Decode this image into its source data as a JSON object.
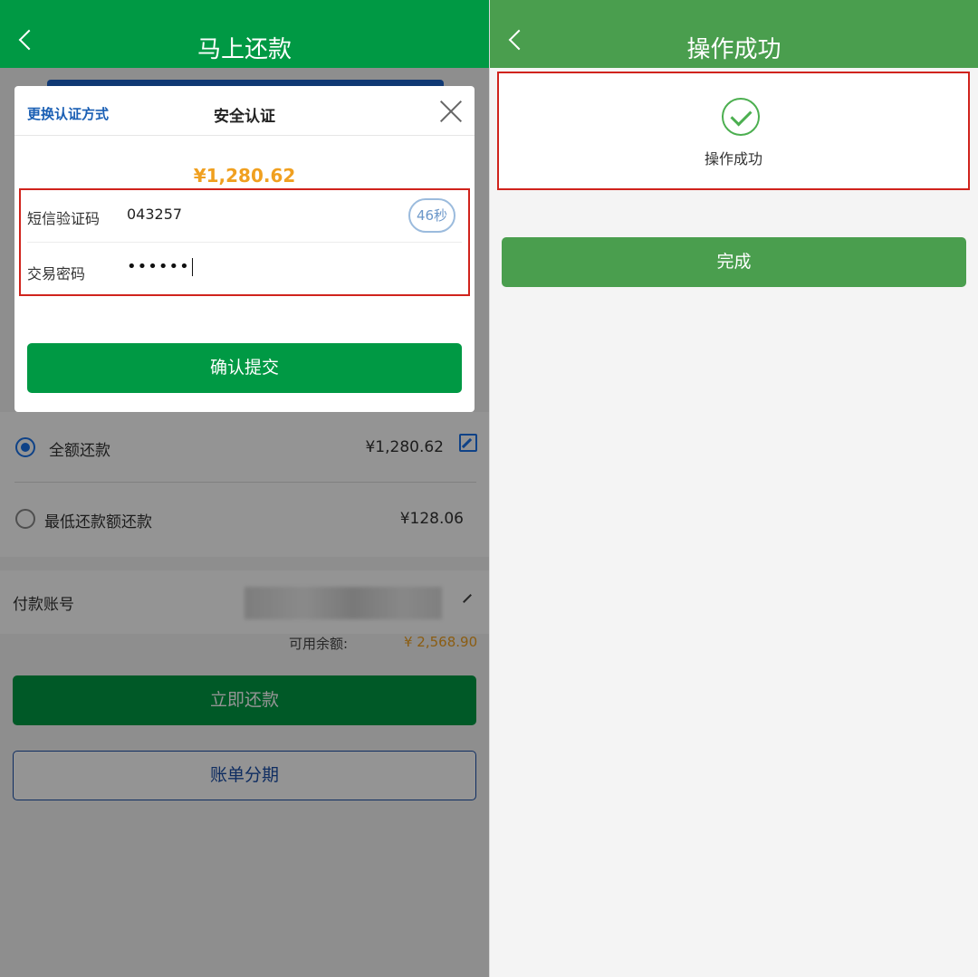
{
  "left": {
    "nav_title": "马上还款",
    "options": [
      {
        "label": "全额还款",
        "amount": "¥1,280.62",
        "selected": true
      },
      {
        "label": "最低还款额还款",
        "amount": "¥128.06",
        "selected": false
      }
    ],
    "account_label": "付款账号",
    "balance_label": "可用余额:",
    "balance_value": "¥ 2,568.90",
    "repay_button": "立即还款",
    "installment_button": "账单分期",
    "modal": {
      "switch_method": "更换认证方式",
      "title": "安全认证",
      "amount": "¥1,280.62",
      "sms_label": "短信验证码",
      "sms_value": "043257",
      "countdown": "46秒",
      "password_label": "交易密码",
      "password_mask": "••••••",
      "confirm_button": "确认提交"
    }
  },
  "right": {
    "nav_title": "操作成功",
    "success_text": "操作成功",
    "done_button": "完成"
  },
  "colors": {
    "nav_green_left": "#009944",
    "nav_green_right": "#4a9e4e",
    "amount_orange": "#f0a020",
    "link_blue": "#1a5fb4",
    "highlight_red": "#d0231c"
  }
}
